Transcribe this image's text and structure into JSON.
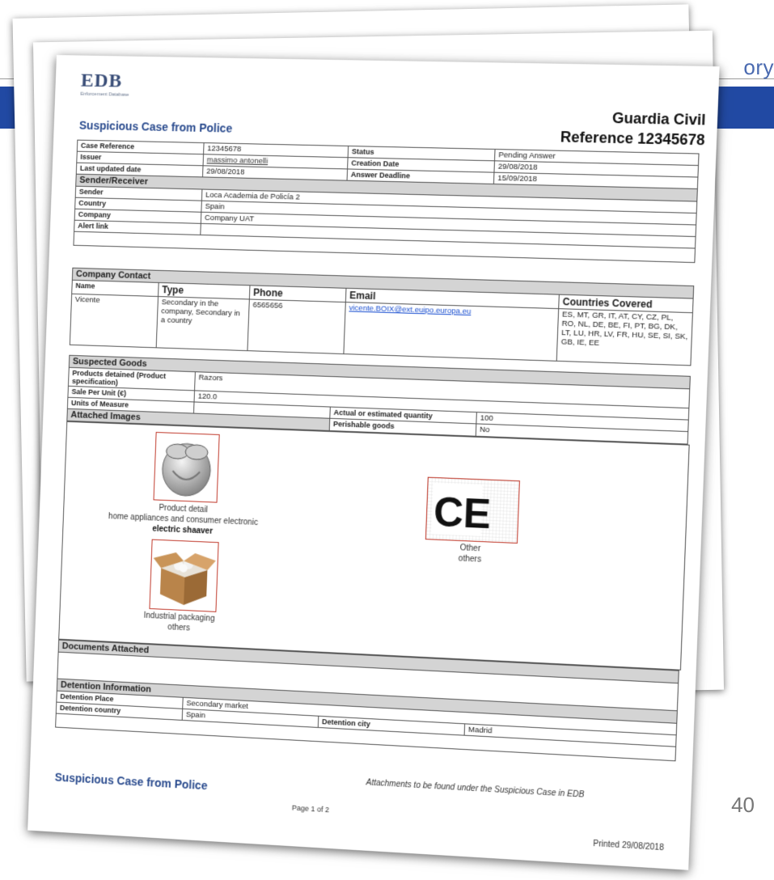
{
  "background": {
    "story_text": "ory",
    "slide_number": "40"
  },
  "document": {
    "logo_text": "EDB",
    "logo_subtitle": "Enforcement Database",
    "title": "Suspicious Case from Police",
    "header_org": "Guardia Civil",
    "header_reference": "Reference 12345678",
    "case": {
      "case_reference_label": "Case Reference",
      "case_reference": "12345678",
      "issuer_label": "Issuer",
      "issuer": "massimo antonelli",
      "last_updated_label": "Last updated date",
      "last_updated": "29/08/2018",
      "status_label": "Status",
      "status": "Pending Answer",
      "creation_date_label": "Creation Date",
      "creation_date": "29/08/2018",
      "answer_deadline_label": "Answer Deadline",
      "answer_deadline": "15/09/2018"
    },
    "sender_receiver": {
      "section": "Sender/Receiver",
      "sender_label": "Sender",
      "sender": "Loca Academia de Policía 2",
      "country_label": "Country",
      "country": "Spain",
      "company_label": "Company",
      "company": "Company UAT",
      "alert_link_label": "Alert link",
      "alert_link": ""
    },
    "company_contact": {
      "section": "Company Contact",
      "name_label": "Name",
      "type_label": "Type",
      "phone_label": "Phone",
      "email_label": "Email",
      "countries_label": "Countries Covered",
      "name": "Vicente",
      "type": "Secondary in the company, Secondary in a country",
      "phone": "6565656",
      "email": "vicente.BOIX@ext.euipo.europa.eu",
      "countries": "ES, MT, GR, IT, AT, CY, CZ, PL, RO, NL, DE, BE, FI, PT, BG, DK, LT, LU, HR, LV, FR, HU, SE, SI, SK, GB, IE, EE"
    },
    "suspected_goods": {
      "section": "Suspected Goods",
      "products_label": "Products detained (Product specification)",
      "products": "Razors",
      "sale_label": "Sale Per Unit (€)",
      "sale": "120.0",
      "units_label": "Units of Measure",
      "units": "",
      "quantity_label": "Actual or estimated quantity",
      "quantity": "100",
      "perishable_label": "Perishable goods",
      "perishable": "No"
    },
    "attached_images": {
      "section": "Attached Images",
      "items": [
        {
          "title": "Product detail",
          "category": "home appliances and consumer electronic",
          "name": "electric shaaver",
          "icon": "shaver-image"
        },
        {
          "title": "Other",
          "category": "others",
          "name": "",
          "icon": "ce-mark-image"
        },
        {
          "title": "Industrial packaging",
          "category": "others",
          "name": "",
          "icon": "cardboard-box-image"
        }
      ]
    },
    "documents_section": "Documents Attached",
    "detention": {
      "section": "Detention Information",
      "place_label": "Detention Place",
      "place": "Secondary market",
      "country_label": "Detention country",
      "country": "Spain",
      "city_label": "Detention city",
      "city": "Madrid",
      "note": "Attachments to be found under the Suspicious Case in EDB"
    },
    "footer_title": "Suspicious Case from Police",
    "page_number": "Page 1 of 2",
    "printed": "Printed 29/08/2018",
    "ce_text": "CE"
  },
  "colors": {
    "band": "#2149a3",
    "title": "#2a4b8e",
    "section_fill": "#d4d4d4",
    "image_border": "#c0392b"
  }
}
